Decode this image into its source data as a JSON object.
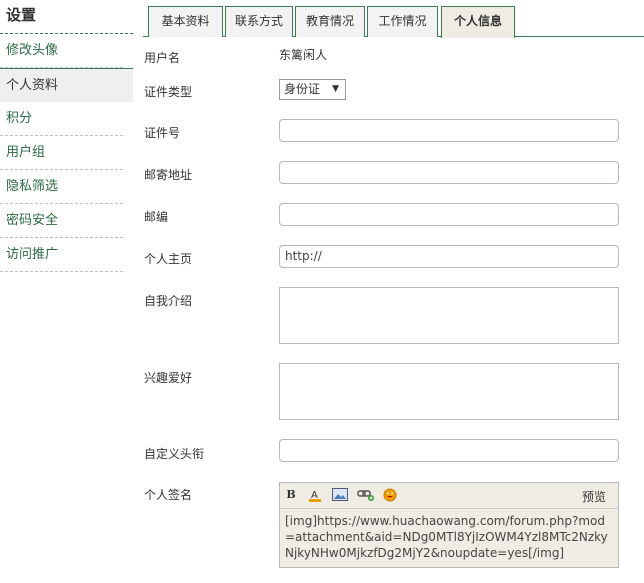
{
  "sidebar": {
    "title": "设置",
    "items": [
      {
        "label": "修改头像"
      },
      {
        "label": "个人资料"
      },
      {
        "label": "积分"
      },
      {
        "label": "用户组"
      },
      {
        "label": "隐私筛选"
      },
      {
        "label": "密码安全"
      },
      {
        "label": "访问推广"
      }
    ],
    "active_index": 1
  },
  "tabs": [
    {
      "label": "基本资料"
    },
    {
      "label": "联系方式"
    },
    {
      "label": "教育情况"
    },
    {
      "label": "工作情况"
    },
    {
      "label": "个人信息"
    }
  ],
  "form": {
    "username_label": "用户名",
    "username_value": "东篱闲人",
    "id_type_label": "证件类型",
    "id_type_value": "身份证",
    "id_number_label": "证件号",
    "address_label": "邮寄地址",
    "zipcode_label": "邮编",
    "homepage_label": "个人主页",
    "homepage_value": "http://",
    "bio_label": "自我介绍",
    "hobby_label": "兴趣爱好",
    "custom_title_label": "自定义头衔",
    "signature_label": "个人签名"
  },
  "editor": {
    "preview_label": "预览",
    "content": "[img]https://www.huachaowang.com/forum.php?mod=attachment&aid=NDg0MTl8YjIzOWM4Yzl8MTc2NzkyNjkyNHw0MjkzfDg2MjY2&noupdate=yes[/img]",
    "toolbar": [
      "bold-icon",
      "font-color-icon",
      "image-icon",
      "link-icon",
      "smiley-icon"
    ]
  }
}
